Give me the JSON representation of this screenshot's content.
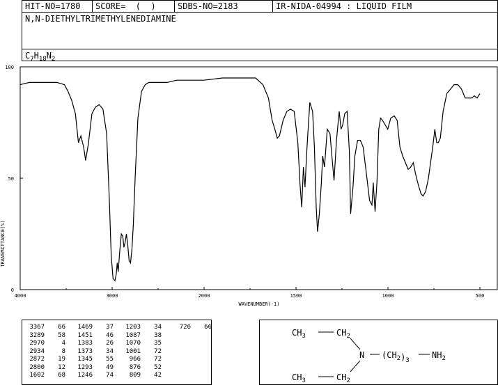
{
  "header": {
    "hit_no": "HIT-NO=1780",
    "score": "SCORE=  (  )",
    "sdbs_no": "SDBS-NO=2183",
    "ir_nida": "IR-NIDA-04994 : LIQUID FILM"
  },
  "compound": {
    "name": "N,N-DIETHYLTRIMETHYLENEDIAMINE",
    "formula_parts": [
      {
        "text": "C",
        "sub": false
      },
      {
        "text": "7",
        "sub": true
      },
      {
        "text": "H",
        "sub": false
      },
      {
        "text": "18",
        "sub": true
      },
      {
        "text": "N",
        "sub": false
      },
      {
        "text": "2",
        "sub": true
      }
    ]
  },
  "chart_data": {
    "type": "line",
    "xlabel": "WAVENUMBER(-1)",
    "ylabel": "TRANSMITTANCE(%)",
    "x_ticks": [
      4000,
      3000,
      2000,
      1500,
      1000,
      500
    ],
    "y_ticks": [
      0,
      50,
      100
    ],
    "xlim": [
      4000,
      500
    ],
    "ylim": [
      0,
      100
    ],
    "axis_segments": [
      [
        4000,
        2000
      ],
      [
        2000,
        500
      ]
    ],
    "series": [
      {
        "x": [
          4000,
          3900,
          3800,
          3700,
          3600,
          3520,
          3480,
          3440,
          3400,
          3367,
          3340,
          3310,
          3289,
          3260,
          3220,
          3180,
          3140,
          3100,
          3060,
          3030,
          3010,
          2990,
          2970,
          2955,
          2945,
          2934,
          2920,
          2900,
          2885,
          2872,
          2860,
          2845,
          2830,
          2815,
          2800,
          2785,
          2770,
          2750,
          2720,
          2680,
          2640,
          2600,
          2500,
          2400,
          2300,
          2200,
          2100,
          2000,
          1900,
          1800,
          1760,
          1720,
          1680,
          1650,
          1630,
          1615,
          1602,
          1590,
          1570,
          1550,
          1530,
          1510,
          1490,
          1478,
          1469,
          1460,
          1451,
          1440,
          1425,
          1410,
          1400,
          1390,
          1383,
          1373,
          1362,
          1355,
          1345,
          1330,
          1315,
          1305,
          1293,
          1280,
          1265,
          1255,
          1246,
          1235,
          1222,
          1210,
          1203,
          1190,
          1180,
          1165,
          1150,
          1135,
          1120,
          1100,
          1087,
          1080,
          1070,
          1060,
          1050,
          1040,
          1030,
          1015,
          1001,
          985,
          966,
          950,
          935,
          920,
          905,
          890,
          876,
          862,
          850,
          835,
          820,
          809,
          795,
          780,
          768,
          755,
          745,
          735,
          726,
          715,
          700,
          680,
          660,
          640,
          620,
          600,
          580,
          560,
          545,
          530,
          515,
          500
        ],
        "y": [
          92,
          93,
          93,
          93,
          93,
          92,
          89,
          85,
          79,
          66,
          69,
          64,
          58,
          65,
          79,
          82,
          83,
          81,
          70,
          40,
          15,
          5,
          4,
          7,
          12,
          8,
          16,
          25,
          24,
          19,
          21,
          25,
          20,
          13,
          12,
          18,
          29,
          50,
          77,
          89,
          92,
          93,
          93,
          93,
          94,
          94,
          94,
          94,
          95,
          95,
          95,
          95,
          92,
          86,
          76,
          72,
          68,
          69,
          76,
          80,
          81,
          80,
          66,
          47,
          37,
          55,
          46,
          64,
          84,
          80,
          64,
          37,
          26,
          34,
          48,
          60,
          55,
          72,
          70,
          60,
          49,
          67,
          80,
          72,
          74,
          79,
          80,
          62,
          34,
          46,
          60,
          67,
          67,
          64,
          54,
          40,
          38,
          48,
          35,
          48,
          72,
          77,
          76,
          74,
          72,
          77,
          78,
          76,
          64,
          60,
          57,
          54,
          55,
          57,
          52,
          47,
          43,
          42,
          44,
          50,
          57,
          65,
          72,
          66,
          66,
          68,
          80,
          88,
          90,
          92,
          92,
          90,
          86,
          86,
          86,
          87,
          86,
          88
        ]
      }
    ]
  },
  "peak_table": {
    "columns": [
      [
        [
          "3367",
          "66"
        ],
        [
          "3289",
          "58"
        ],
        [
          "2970",
          "4"
        ],
        [
          "2934",
          "8"
        ],
        [
          "2872",
          "19"
        ],
        [
          "2800",
          "12"
        ],
        [
          "1602",
          "68"
        ]
      ],
      [
        [
          "1469",
          "37"
        ],
        [
          "1451",
          "46"
        ],
        [
          "1383",
          "26"
        ],
        [
          "1373",
          "34"
        ],
        [
          "1345",
          "55"
        ],
        [
          "1293",
          "49"
        ],
        [
          "1246",
          "74"
        ]
      ],
      [
        [
          "1203",
          "34"
        ],
        [
          "1087",
          "38"
        ],
        [
          "1070",
          "35"
        ],
        [
          "1001",
          "72"
        ],
        [
          "966",
          "72"
        ],
        [
          "876",
          "52"
        ],
        [
          "809",
          "42"
        ]
      ],
      [
        [
          "726",
          "66"
        ]
      ]
    ]
  },
  "structure": {
    "top_left": "CH3",
    "top_right": "CH2",
    "n_atom": "N",
    "chain": "(CH2)3",
    "amine": "NH2",
    "bottom_left": "CH3",
    "bottom_right": "CH2"
  }
}
